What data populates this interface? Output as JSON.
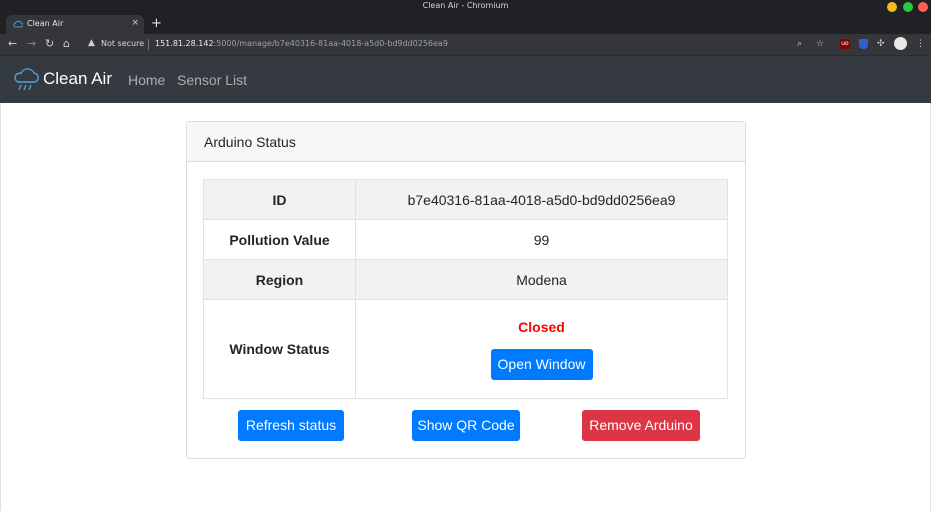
{
  "window": {
    "title": "Clean Air - Chromium",
    "controls": {
      "minimize_color": "#f5b91a",
      "maximize_color": "#27c93f",
      "close_color": "#ff5f57"
    }
  },
  "browser": {
    "tab": {
      "title": "Clean Air",
      "close": "×"
    },
    "new_tab": "+",
    "security_label": "Not secure",
    "url": {
      "host": "151.81.28.142",
      "rest": ":5000/manage/b7e40316-81aa-4018-a5d0-bd9dd0256ea9"
    },
    "extension_badge": "uo"
  },
  "navbar": {
    "brand": "Clean Air",
    "links": [
      "Home",
      "Sensor List"
    ],
    "background": "#343a40"
  },
  "card": {
    "header": "Arduino Status",
    "rows": {
      "id": {
        "label": "ID",
        "value": "b7e40316-81aa-4018-a5d0-bd9dd0256ea9"
      },
      "pollution": {
        "label": "Pollution Value",
        "value": "99"
      },
      "region": {
        "label": "Region",
        "value": "Modena"
      },
      "window": {
        "label": "Window Status",
        "value": "Closed",
        "value_color": "#ff0000",
        "action": "Open Window"
      }
    },
    "buttons": {
      "refresh": "Refresh status",
      "qr": "Show QR Code",
      "remove": "Remove Arduino"
    },
    "colors": {
      "primary": "#007bff",
      "danger": "#dc3545"
    }
  }
}
